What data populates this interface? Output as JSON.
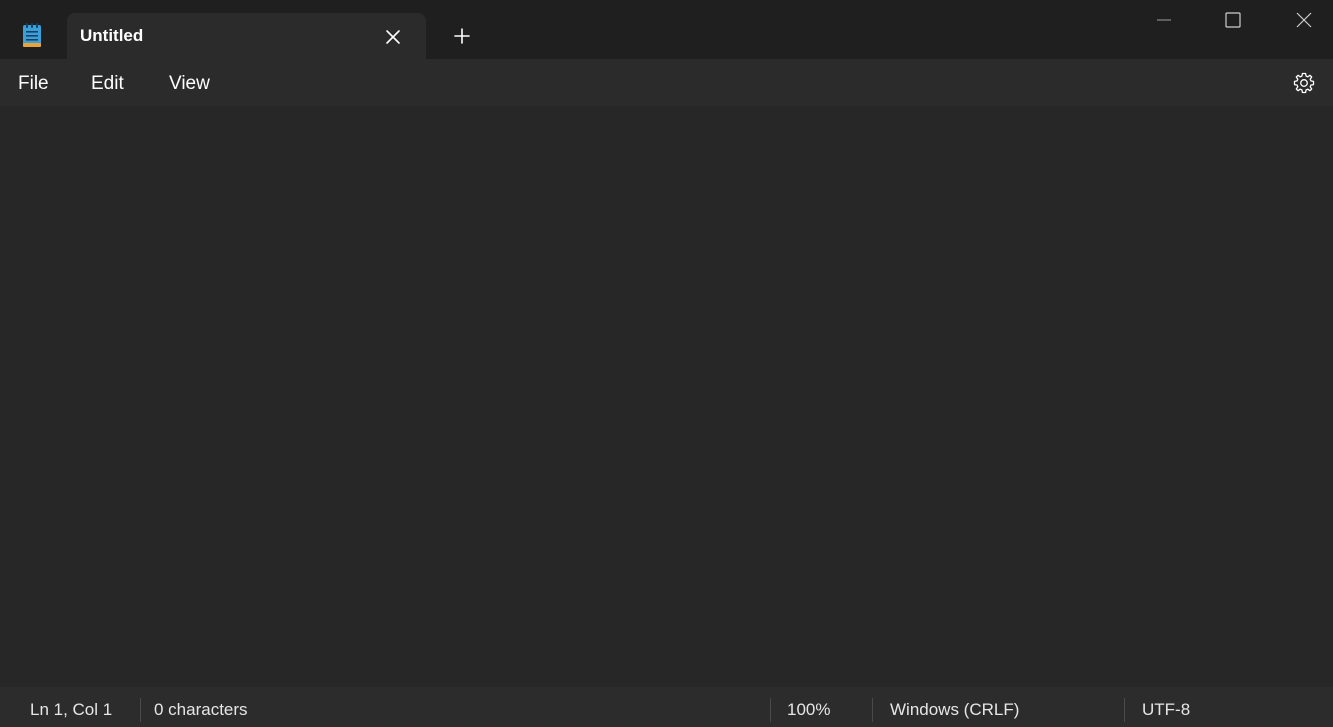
{
  "titlebar": {
    "app_icon": "notepad-icon",
    "tab": {
      "title": "Untitled",
      "close_icon": "close-icon"
    },
    "new_tab_icon": "plus-icon",
    "window_controls": {
      "minimize_icon": "minimize-icon",
      "maximize_icon": "maximize-icon",
      "close_icon": "close-icon"
    }
  },
  "menubar": {
    "items": [
      {
        "label": "File"
      },
      {
        "label": "Edit"
      },
      {
        "label": "View"
      }
    ],
    "settings_icon": "gear-icon"
  },
  "editor": {
    "content": ""
  },
  "statusbar": {
    "position": "Ln 1, Col 1",
    "characters": "0 characters",
    "zoom": "100%",
    "line_ending": "Windows (CRLF)",
    "encoding": "UTF-8"
  },
  "colors": {
    "titlebar_bg": "#1f1f1f",
    "tab_bg": "#2b2b2b",
    "editor_bg": "#272727",
    "status_bg": "#2c2c2c",
    "icon_accent": "#3aa0d8"
  }
}
